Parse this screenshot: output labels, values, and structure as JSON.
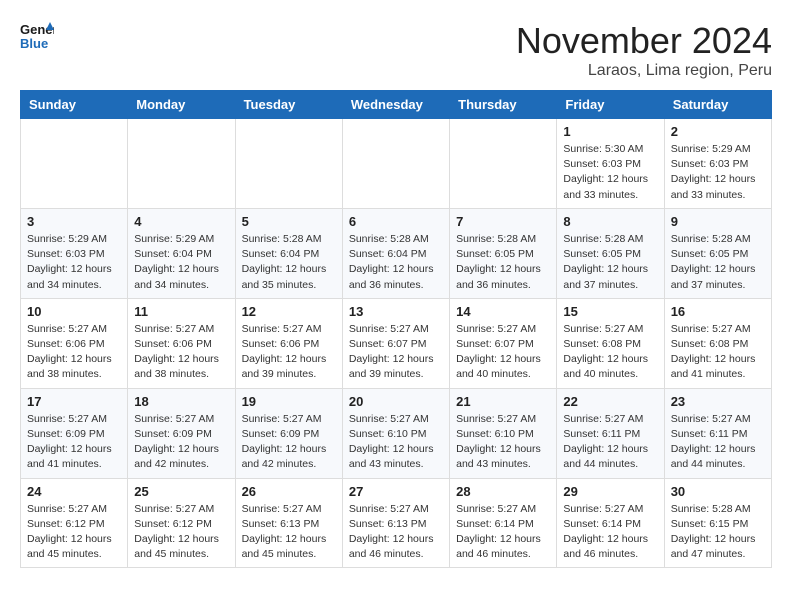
{
  "logo": {
    "line1": "General",
    "line2": "Blue"
  },
  "title": "November 2024",
  "subtitle": "Laraos, Lima region, Peru",
  "weekdays": [
    "Sunday",
    "Monday",
    "Tuesday",
    "Wednesday",
    "Thursday",
    "Friday",
    "Saturday"
  ],
  "weeks": [
    [
      {
        "day": "",
        "info": ""
      },
      {
        "day": "",
        "info": ""
      },
      {
        "day": "",
        "info": ""
      },
      {
        "day": "",
        "info": ""
      },
      {
        "day": "",
        "info": ""
      },
      {
        "day": "1",
        "info": "Sunrise: 5:30 AM\nSunset: 6:03 PM\nDaylight: 12 hours and 33 minutes."
      },
      {
        "day": "2",
        "info": "Sunrise: 5:29 AM\nSunset: 6:03 PM\nDaylight: 12 hours and 33 minutes."
      }
    ],
    [
      {
        "day": "3",
        "info": "Sunrise: 5:29 AM\nSunset: 6:03 PM\nDaylight: 12 hours and 34 minutes."
      },
      {
        "day": "4",
        "info": "Sunrise: 5:29 AM\nSunset: 6:04 PM\nDaylight: 12 hours and 34 minutes."
      },
      {
        "day": "5",
        "info": "Sunrise: 5:28 AM\nSunset: 6:04 PM\nDaylight: 12 hours and 35 minutes."
      },
      {
        "day": "6",
        "info": "Sunrise: 5:28 AM\nSunset: 6:04 PM\nDaylight: 12 hours and 36 minutes."
      },
      {
        "day": "7",
        "info": "Sunrise: 5:28 AM\nSunset: 6:05 PM\nDaylight: 12 hours and 36 minutes."
      },
      {
        "day": "8",
        "info": "Sunrise: 5:28 AM\nSunset: 6:05 PM\nDaylight: 12 hours and 37 minutes."
      },
      {
        "day": "9",
        "info": "Sunrise: 5:28 AM\nSunset: 6:05 PM\nDaylight: 12 hours and 37 minutes."
      }
    ],
    [
      {
        "day": "10",
        "info": "Sunrise: 5:27 AM\nSunset: 6:06 PM\nDaylight: 12 hours and 38 minutes."
      },
      {
        "day": "11",
        "info": "Sunrise: 5:27 AM\nSunset: 6:06 PM\nDaylight: 12 hours and 38 minutes."
      },
      {
        "day": "12",
        "info": "Sunrise: 5:27 AM\nSunset: 6:06 PM\nDaylight: 12 hours and 39 minutes."
      },
      {
        "day": "13",
        "info": "Sunrise: 5:27 AM\nSunset: 6:07 PM\nDaylight: 12 hours and 39 minutes."
      },
      {
        "day": "14",
        "info": "Sunrise: 5:27 AM\nSunset: 6:07 PM\nDaylight: 12 hours and 40 minutes."
      },
      {
        "day": "15",
        "info": "Sunrise: 5:27 AM\nSunset: 6:08 PM\nDaylight: 12 hours and 40 minutes."
      },
      {
        "day": "16",
        "info": "Sunrise: 5:27 AM\nSunset: 6:08 PM\nDaylight: 12 hours and 41 minutes."
      }
    ],
    [
      {
        "day": "17",
        "info": "Sunrise: 5:27 AM\nSunset: 6:09 PM\nDaylight: 12 hours and 41 minutes."
      },
      {
        "day": "18",
        "info": "Sunrise: 5:27 AM\nSunset: 6:09 PM\nDaylight: 12 hours and 42 minutes."
      },
      {
        "day": "19",
        "info": "Sunrise: 5:27 AM\nSunset: 6:09 PM\nDaylight: 12 hours and 42 minutes."
      },
      {
        "day": "20",
        "info": "Sunrise: 5:27 AM\nSunset: 6:10 PM\nDaylight: 12 hours and 43 minutes."
      },
      {
        "day": "21",
        "info": "Sunrise: 5:27 AM\nSunset: 6:10 PM\nDaylight: 12 hours and 43 minutes."
      },
      {
        "day": "22",
        "info": "Sunrise: 5:27 AM\nSunset: 6:11 PM\nDaylight: 12 hours and 44 minutes."
      },
      {
        "day": "23",
        "info": "Sunrise: 5:27 AM\nSunset: 6:11 PM\nDaylight: 12 hours and 44 minutes."
      }
    ],
    [
      {
        "day": "24",
        "info": "Sunrise: 5:27 AM\nSunset: 6:12 PM\nDaylight: 12 hours and 45 minutes."
      },
      {
        "day": "25",
        "info": "Sunrise: 5:27 AM\nSunset: 6:12 PM\nDaylight: 12 hours and 45 minutes."
      },
      {
        "day": "26",
        "info": "Sunrise: 5:27 AM\nSunset: 6:13 PM\nDaylight: 12 hours and 45 minutes."
      },
      {
        "day": "27",
        "info": "Sunrise: 5:27 AM\nSunset: 6:13 PM\nDaylight: 12 hours and 46 minutes."
      },
      {
        "day": "28",
        "info": "Sunrise: 5:27 AM\nSunset: 6:14 PM\nDaylight: 12 hours and 46 minutes."
      },
      {
        "day": "29",
        "info": "Sunrise: 5:27 AM\nSunset: 6:14 PM\nDaylight: 12 hours and 46 minutes."
      },
      {
        "day": "30",
        "info": "Sunrise: 5:28 AM\nSunset: 6:15 PM\nDaylight: 12 hours and 47 minutes."
      }
    ]
  ]
}
